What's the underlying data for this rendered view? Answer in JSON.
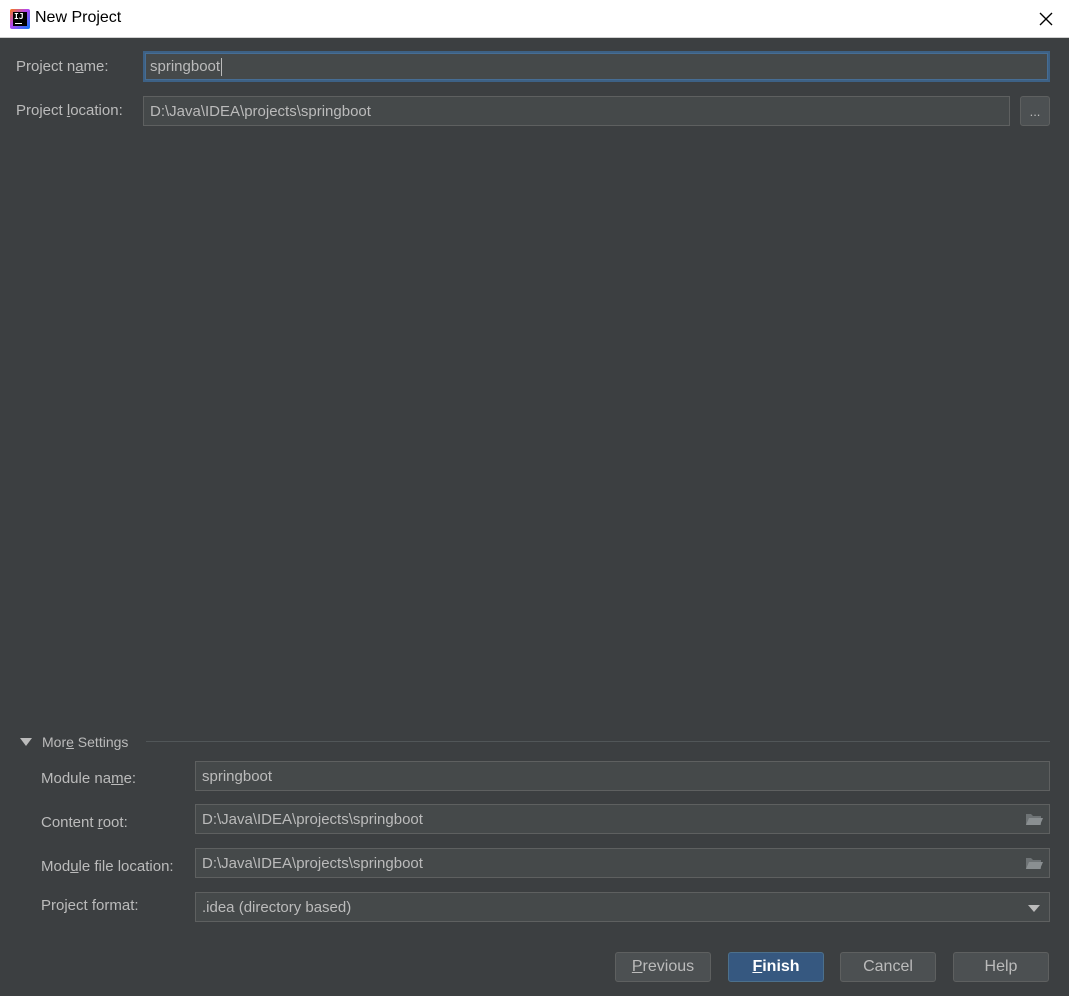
{
  "window": {
    "title": "New Project",
    "app_icon_text": "IJ"
  },
  "project": {
    "name_label_pre": "Project n",
    "name_label_mn": "a",
    "name_label_post": "me:",
    "name_value": "springboot",
    "location_label_pre": "Project ",
    "location_label_mn": "l",
    "location_label_post": "ocation:",
    "location_value": "D:\\Java\\IDEA\\projects\\springboot",
    "browse_label": "..."
  },
  "more_settings": {
    "header_pre": "Mor",
    "header_mn": "e",
    "header_post": " Settings",
    "module_name_label_pre": "Module na",
    "module_name_label_mn": "m",
    "module_name_label_post": "e:",
    "module_name_value": "springboot",
    "content_root_label_pre": "Content ",
    "content_root_label_mn": "r",
    "content_root_label_post": "oot:",
    "content_root_value": "D:\\Java\\IDEA\\projects\\springboot",
    "module_file_label_pre": "Mod",
    "module_file_label_mn": "u",
    "module_file_label_post": "le file location:",
    "module_file_value": "D:\\Java\\IDEA\\projects\\springboot",
    "format_label": "Project format:",
    "format_value": ".idea (directory based)"
  },
  "buttons": {
    "previous_mn": "P",
    "previous_rest": "revious",
    "finish_mn": "F",
    "finish_rest": "inish",
    "cancel": "Cancel",
    "help": "Help"
  },
  "colors": {
    "background": "#3c3f41",
    "field_bg": "#45494a",
    "focus_border": "#3d6185",
    "primary_button": "#365880",
    "text": "#bbbbbb"
  }
}
